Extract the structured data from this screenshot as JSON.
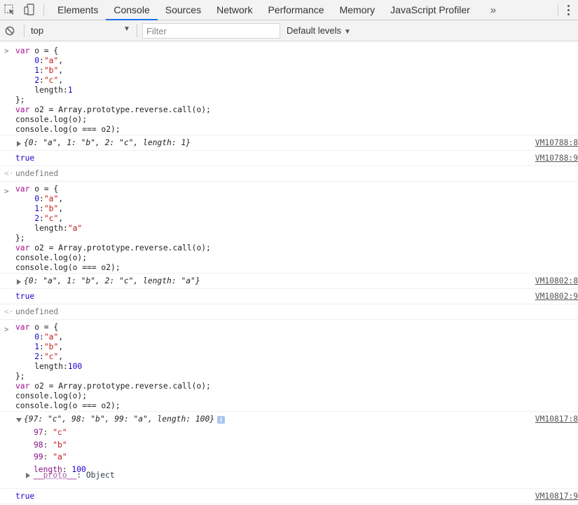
{
  "tabs": {
    "items": [
      "Elements",
      "Console",
      "Sources",
      "Network",
      "Performance",
      "Memory",
      "JavaScript Profiler"
    ],
    "active": "Console",
    "more": "»"
  },
  "filterbar": {
    "context": "top",
    "filter_placeholder": "Filter",
    "levels": "Default levels"
  },
  "console": {
    "input_prompt": ">",
    "return_prompt": "<·",
    "undefined_text": "undefined",
    "true_text": "true",
    "proto_key": "__proto__",
    "proto_value": "Object",
    "blocks": [
      {
        "length_value": "1",
        "log_object": "{0: \"a\", 1: \"b\", 2: \"c\", length: 1}",
        "log_source": "VM10788:8",
        "true_source": "VM10788:9"
      },
      {
        "length_value": "\"a\"",
        "log_object": "{0: \"a\", 1: \"b\", 2: \"c\", length: \"a\"}",
        "log_source": "VM10802:8",
        "true_source": "VM10802:9"
      },
      {
        "length_value": "100",
        "log_object": "{97: \"c\", 98: \"b\", 99: \"a\", length: 100}",
        "log_source": "VM10817:8",
        "true_source": "VM10817:9",
        "expanded": [
          {
            "key": "97",
            "value": "\"c\""
          },
          {
            "key": "98",
            "value": "\"b\""
          },
          {
            "key": "99",
            "value": "\"a\""
          },
          {
            "key": "length",
            "value": "100"
          }
        ]
      }
    ]
  },
  "colors": {
    "keyword": "#aa0d91",
    "string": "#c41a16",
    "number": "#1c00cf",
    "property": "#881280",
    "accent": "#1a73e8"
  }
}
